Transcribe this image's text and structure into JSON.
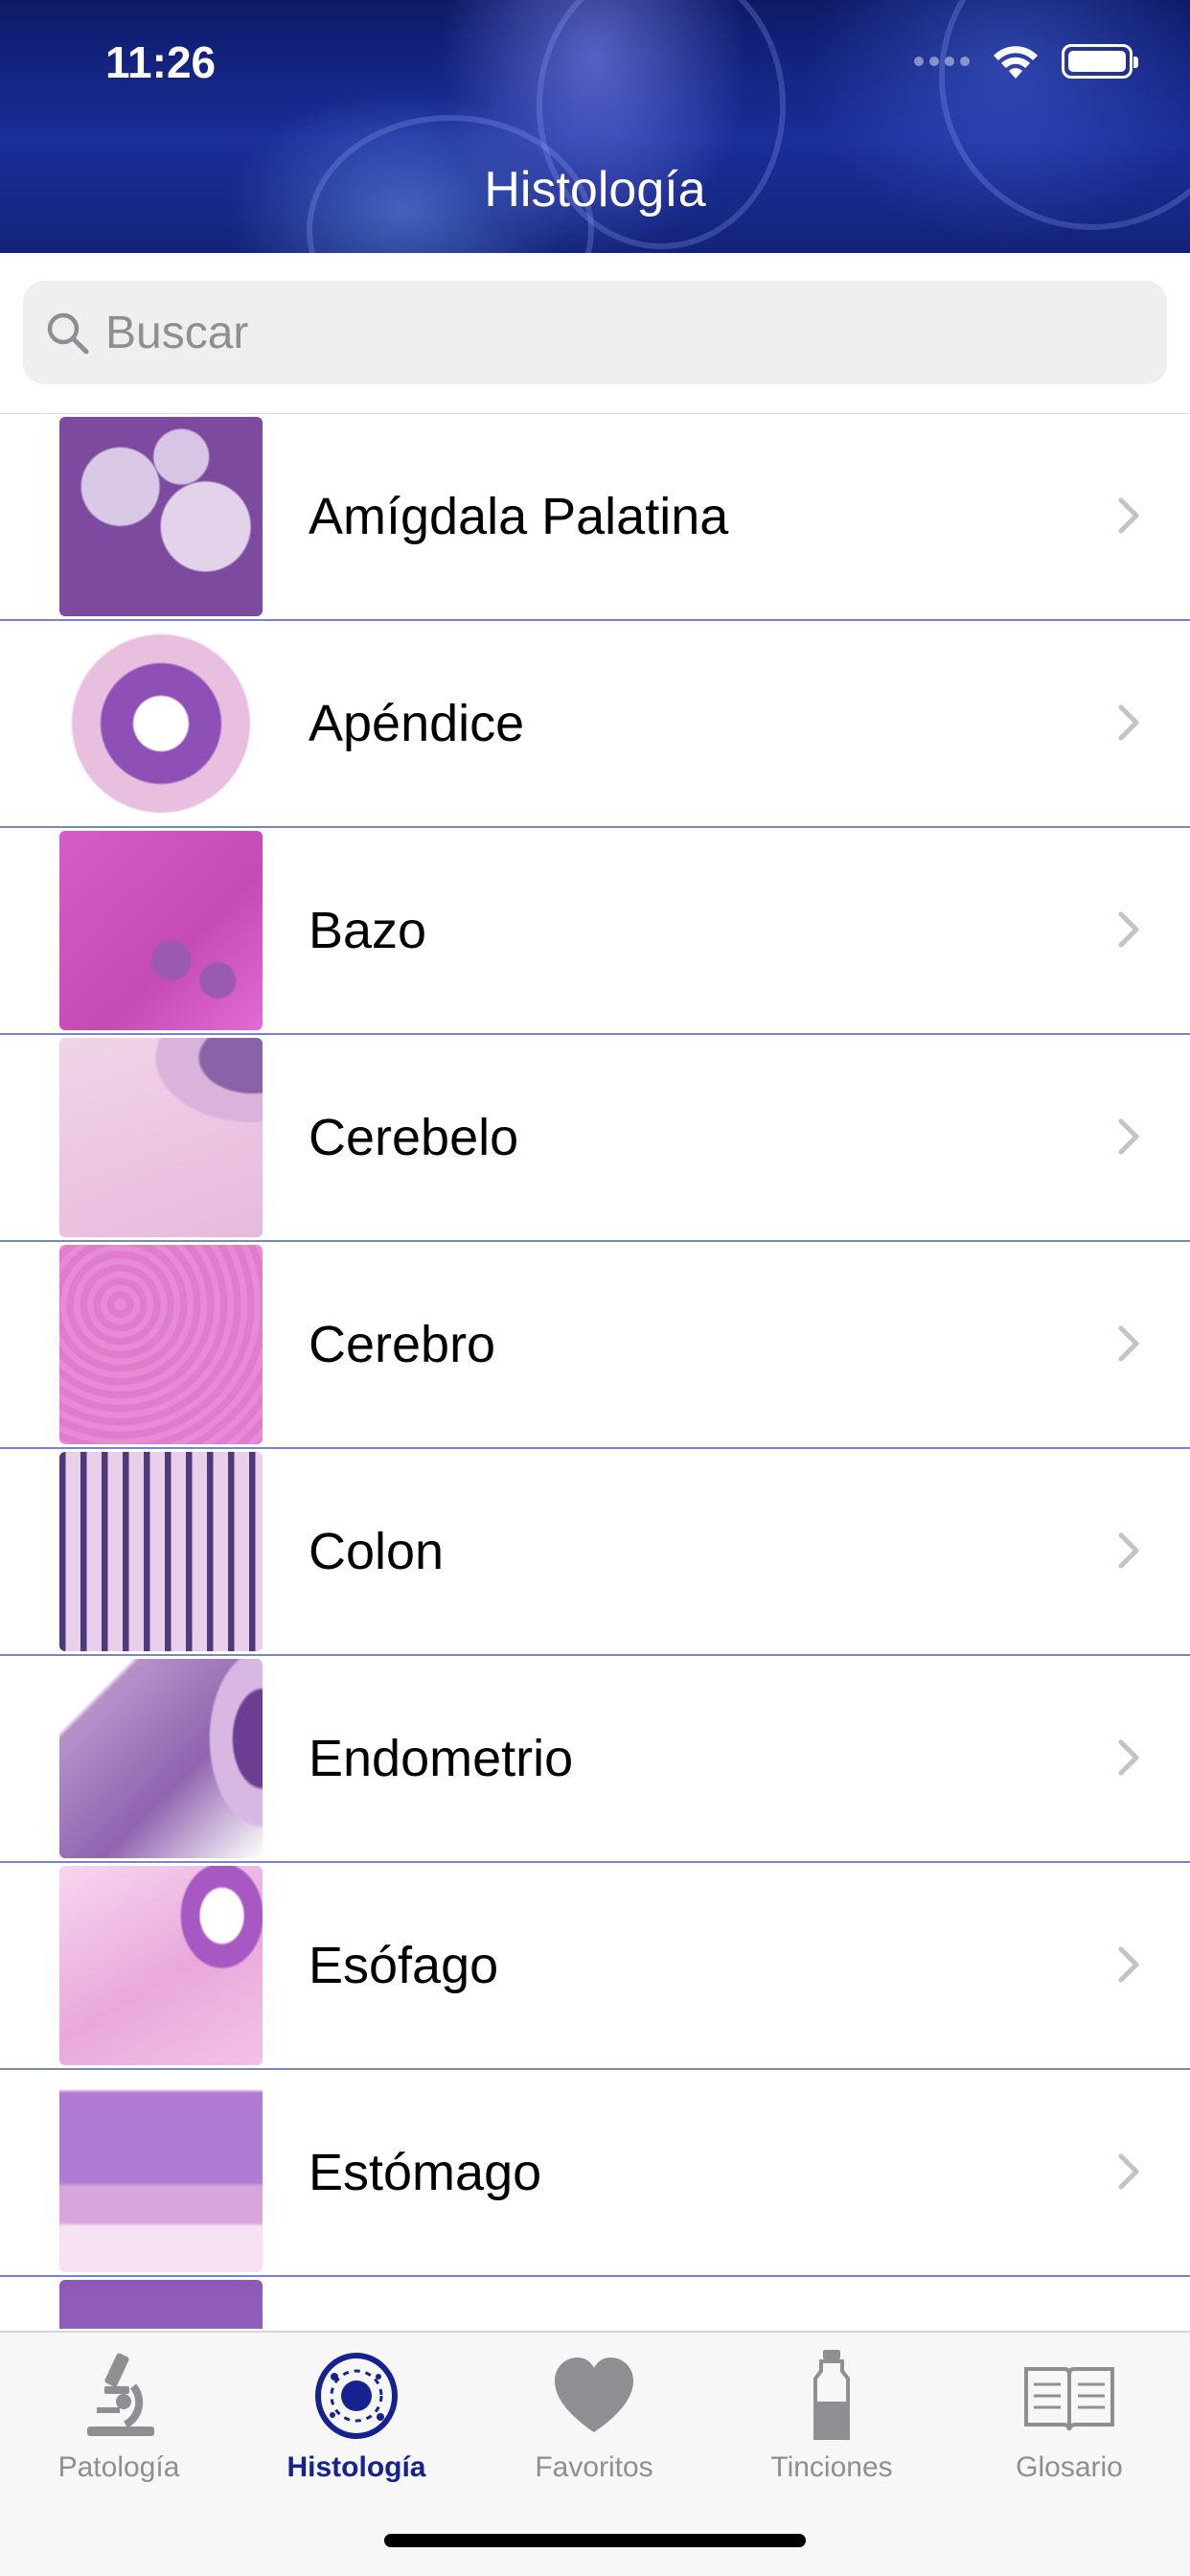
{
  "status_bar": {
    "time": "11:26"
  },
  "nav": {
    "title": "Histología"
  },
  "search": {
    "placeholder": "Buscar",
    "value": ""
  },
  "list": {
    "items": [
      {
        "label": "Amígdala Palatina",
        "thumb": "tissue-image"
      },
      {
        "label": "Apéndice",
        "thumb": "tissue-image"
      },
      {
        "label": "Bazo",
        "thumb": "tissue-image"
      },
      {
        "label": "Cerebelo",
        "thumb": "tissue-image"
      },
      {
        "label": "Cerebro",
        "thumb": "tissue-image"
      },
      {
        "label": "Colon",
        "thumb": "tissue-image"
      },
      {
        "label": "Endometrio",
        "thumb": "tissue-image"
      },
      {
        "label": "Esófago",
        "thumb": "tissue-image"
      },
      {
        "label": "Estómago",
        "thumb": "tissue-image"
      }
    ]
  },
  "tabbar": {
    "tabs": [
      {
        "label": "Patología",
        "icon": "microscope-icon",
        "active": false
      },
      {
        "label": "Histología",
        "icon": "cell-icon",
        "active": true
      },
      {
        "label": "Favoritos",
        "icon": "heart-icon",
        "active": false
      },
      {
        "label": "Tinciones",
        "icon": "bottle-icon",
        "active": false
      },
      {
        "label": "Glosario",
        "icon": "book-icon",
        "active": false
      }
    ]
  },
  "colors": {
    "header_top": "#0d1a66",
    "accent": "#15228f",
    "separator": "#7a82c8",
    "inactive_tab": "#8e8e93",
    "chevron": "#c4c4c8"
  }
}
